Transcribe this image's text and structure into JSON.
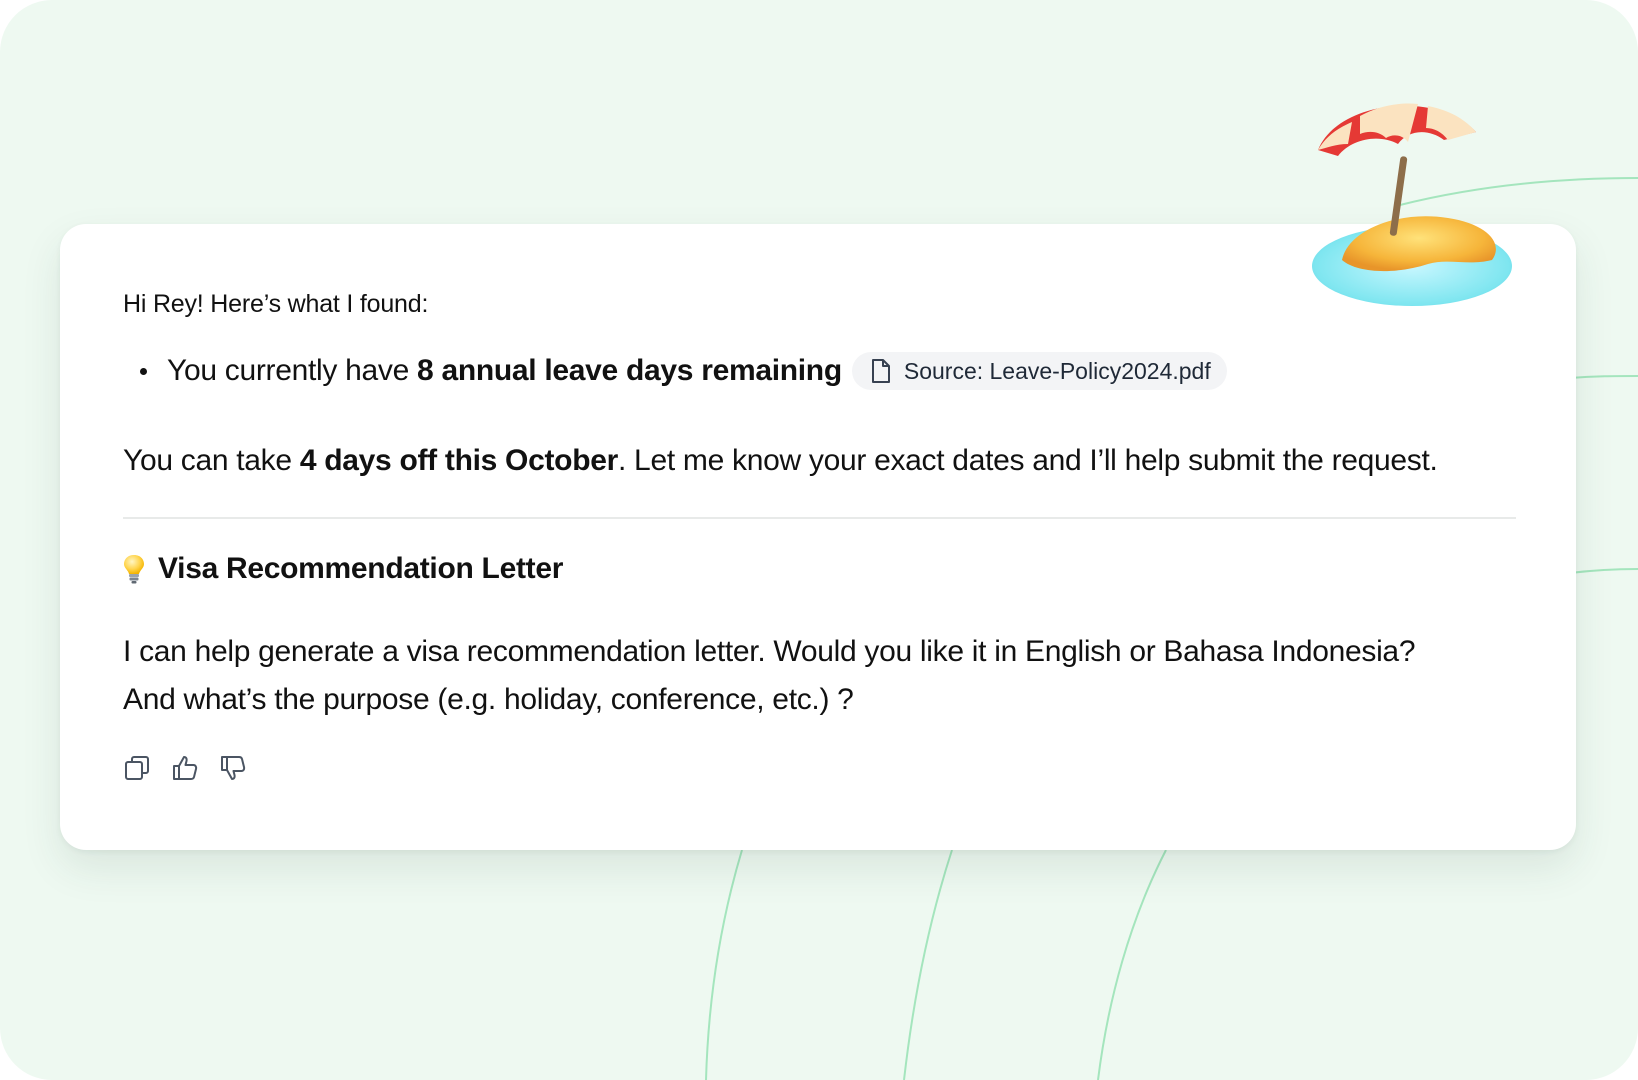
{
  "message": {
    "greeting": "Hi Rey! Here’s what I found:",
    "bullet": {
      "prefix": "You currently have ",
      "emphasis": "8 annual leave days remaining"
    },
    "source_chip": {
      "label": "Source: Leave-Policy2024.pdf",
      "icon": "document-icon"
    },
    "line_two": {
      "prefix": "You can take ",
      "emphasis": "4 days off this October",
      "suffix": ". Let me know your exact dates and I’ll help submit the request."
    },
    "section": {
      "icon": "lightbulb-icon",
      "title": "Visa Recommendation Letter",
      "body_line1": "I can help generate a visa recommendation letter. Would you like it in English or Bahasa Indonesia?",
      "body_line2": "And what’s the purpose (e.g. holiday, conference, etc.) ?"
    },
    "actions": [
      {
        "name": "copy",
        "icon": "copy-icon"
      },
      {
        "name": "thumbs-up",
        "icon": "thumbs-up-icon"
      },
      {
        "name": "thumbs-down",
        "icon": "thumbs-down-icon"
      }
    ]
  },
  "decoration": {
    "sticker": "beach-umbrella-icon"
  },
  "colors": {
    "background": "#eef9f1",
    "arc_stroke": "#9fe3b8",
    "card": "#ffffff",
    "chip": "#f3f4f6"
  }
}
